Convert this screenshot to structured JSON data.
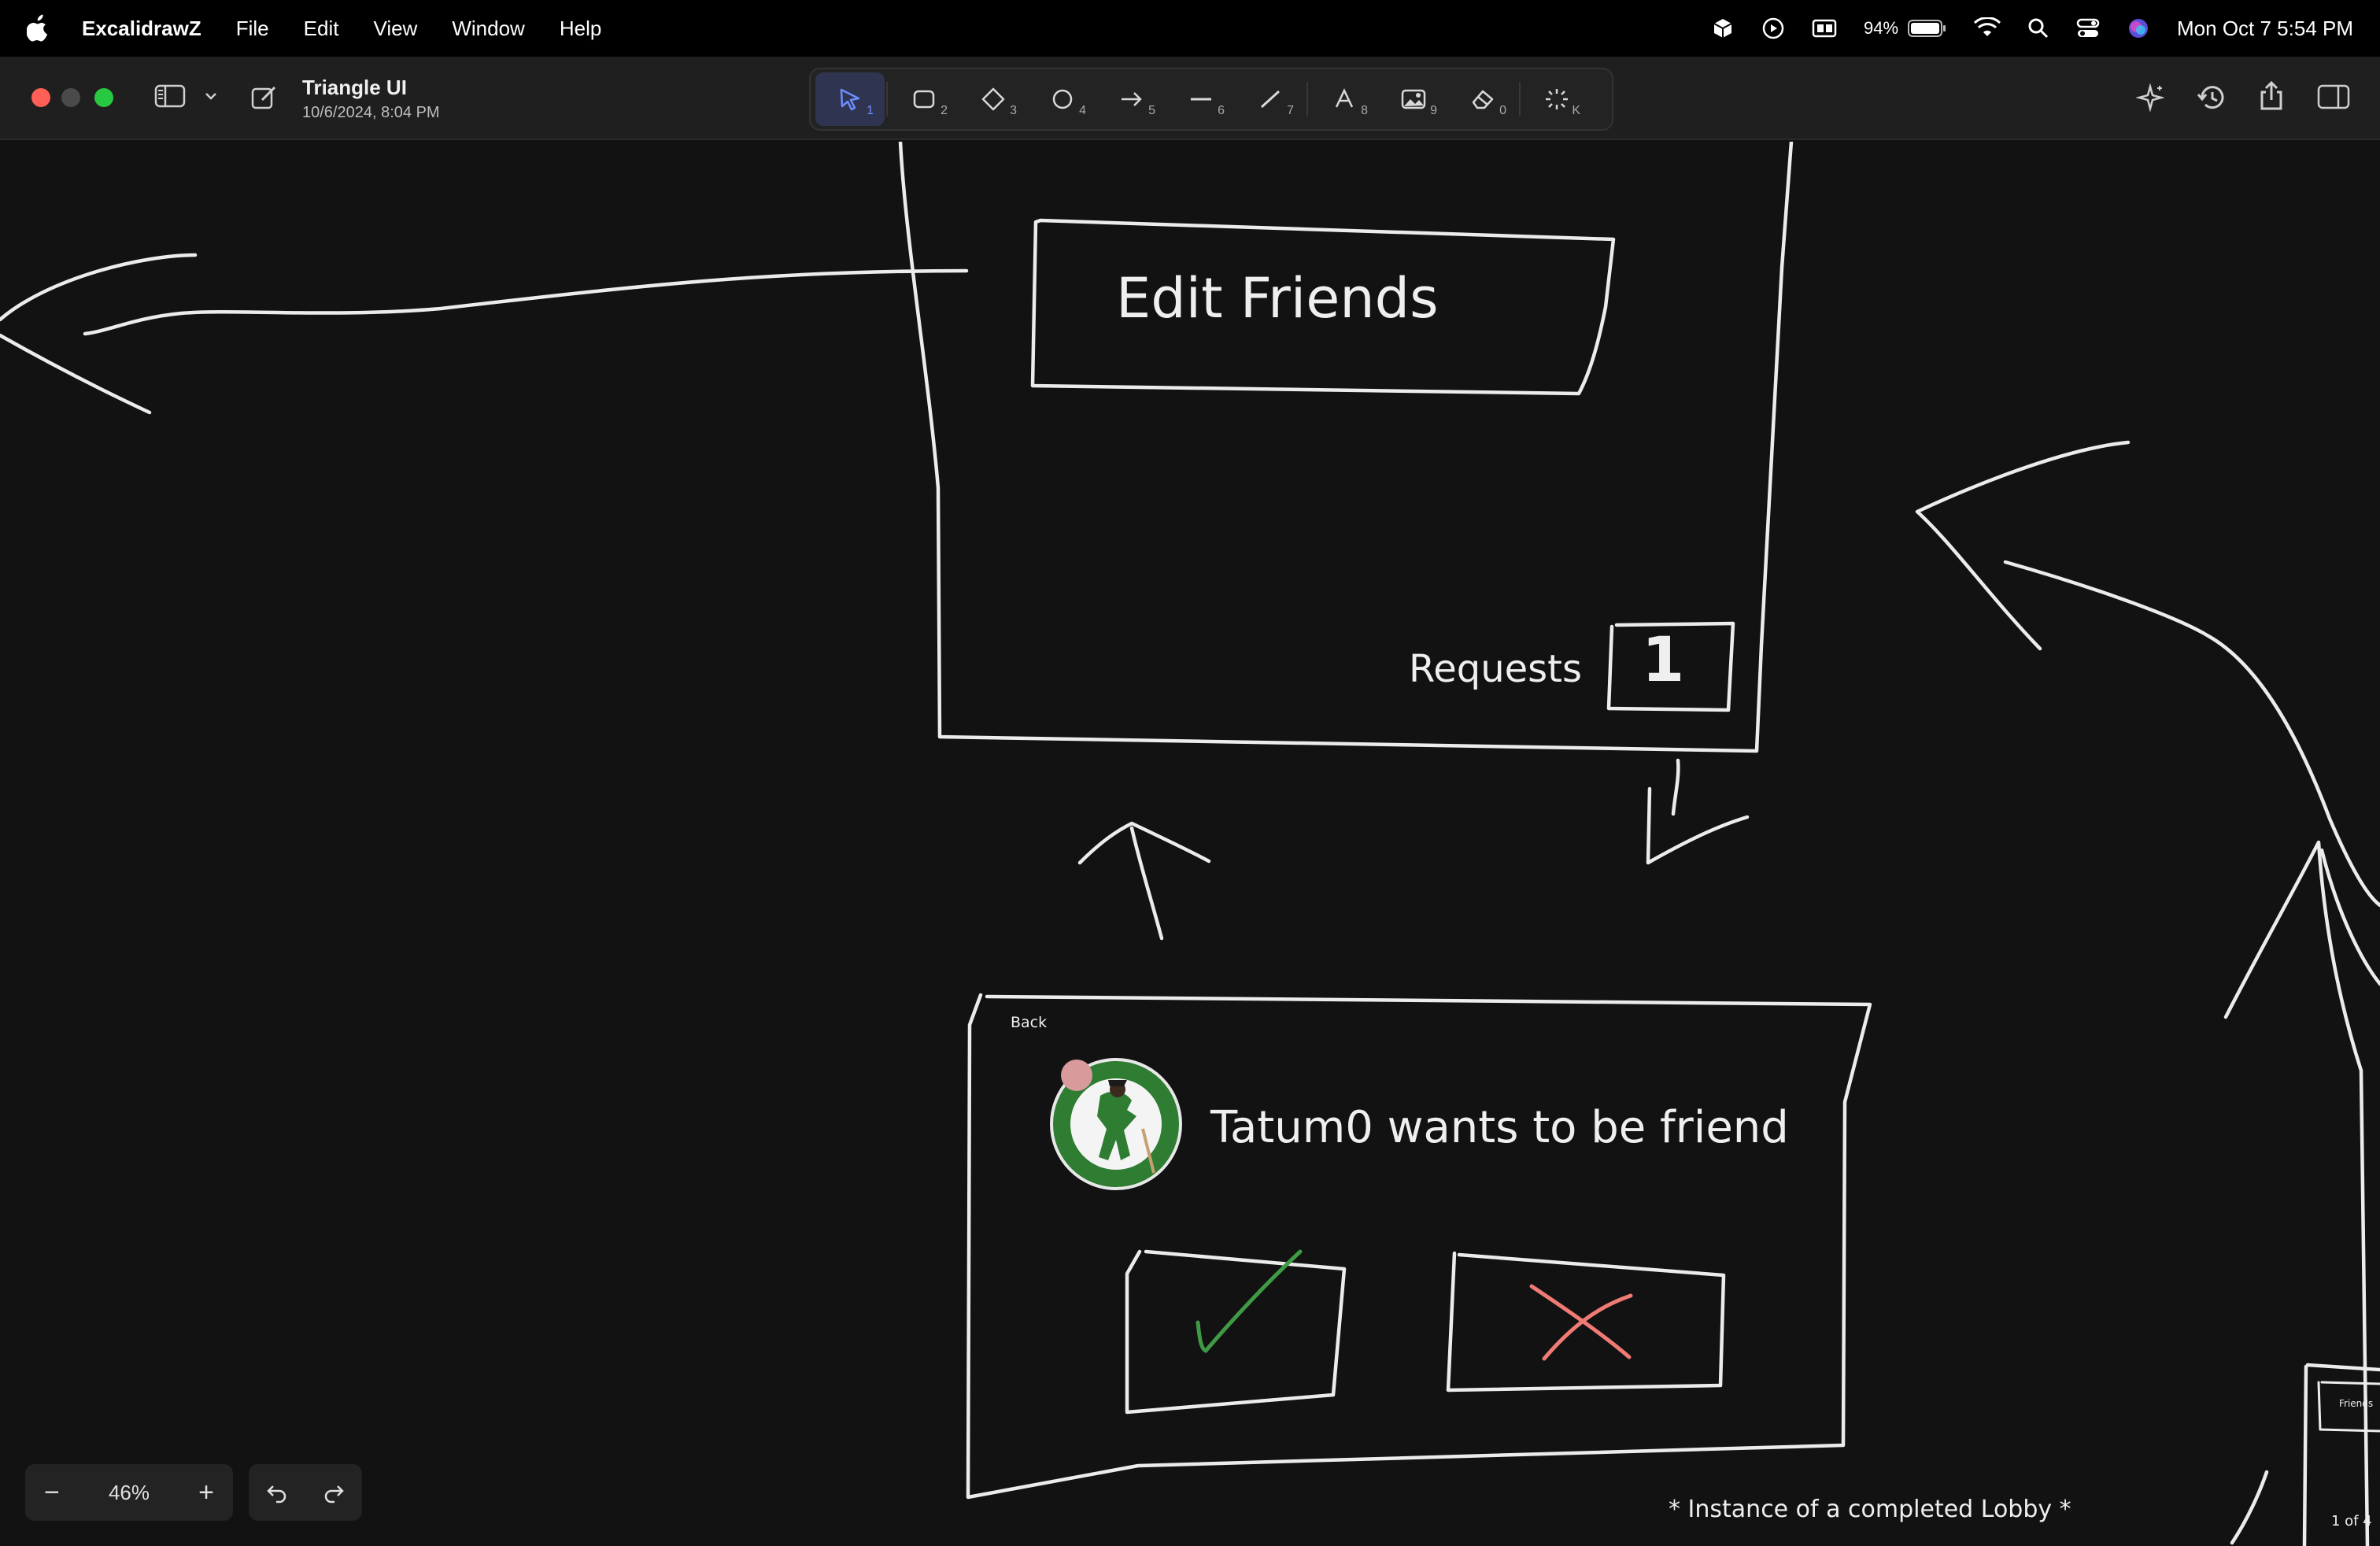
{
  "menubar": {
    "app_name": "ExcalidrawZ",
    "menus": [
      "File",
      "Edit",
      "View",
      "Window",
      "Help"
    ],
    "battery": "94%",
    "datetime": "Mon Oct 7  5:54 PM"
  },
  "toolbar": {
    "doc_title": "Triangle UI",
    "doc_date": "10/6/2024, 8:04 PM",
    "tools": [
      {
        "name": "selection",
        "key": "1"
      },
      {
        "name": "rectangle",
        "key": "2"
      },
      {
        "name": "diamond",
        "key": "3"
      },
      {
        "name": "ellipse",
        "key": "4"
      },
      {
        "name": "arrow",
        "key": "5"
      },
      {
        "name": "line",
        "key": "6"
      },
      {
        "name": "draw",
        "key": "7"
      },
      {
        "name": "text",
        "key": "8"
      },
      {
        "name": "image",
        "key": "9"
      },
      {
        "name": "eraser",
        "key": "0"
      },
      {
        "name": "laser",
        "key": "K"
      }
    ]
  },
  "canvas": {
    "edit_friends": "Edit Friends",
    "requests_label": "Requests",
    "requests_count": "1",
    "back_label": "Back",
    "friend_request_text": "Tatum0 wants to be friend",
    "footnote": "* Instance of a completed Lobby *",
    "mini_friends": "Friends",
    "mini_pager": "1 of 4"
  },
  "zoom": {
    "level": "46%",
    "minus": "−",
    "plus": "+"
  },
  "colors": {
    "accept": "#3f9a46",
    "decline": "#f07a74",
    "accent": "#6d8dff"
  }
}
